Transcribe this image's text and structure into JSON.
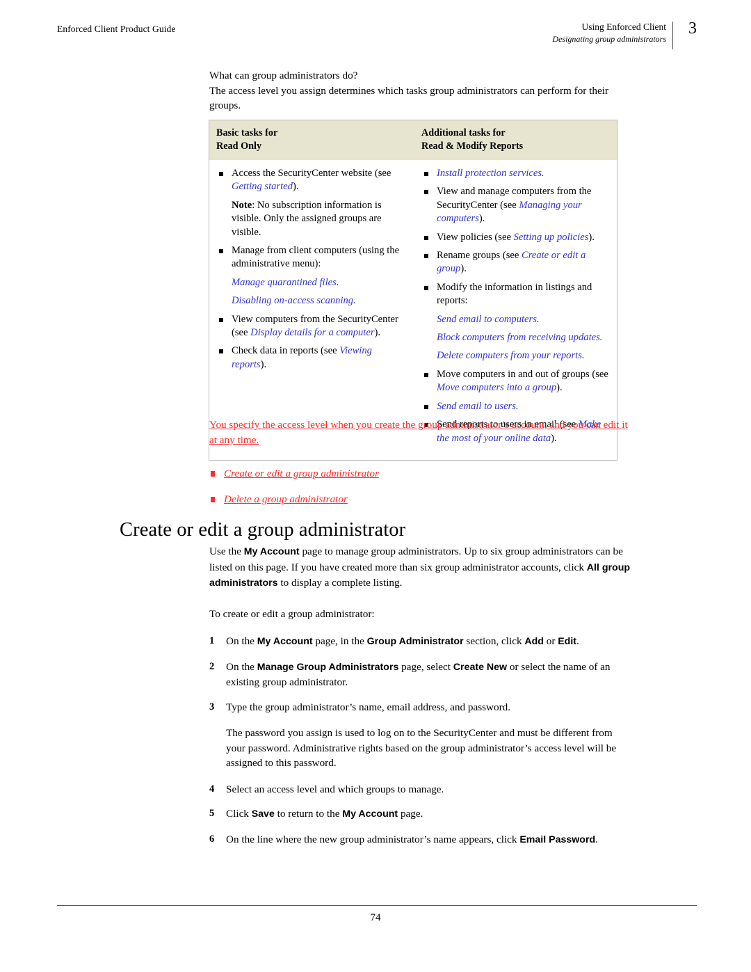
{
  "header": {
    "left": "Enforced Client Product Guide",
    "right_line1": "Using Enforced Client",
    "right_line2": "Designating group administrators",
    "chapter": "3"
  },
  "intro": {
    "line1": "What can group administrators do?",
    "line2": "The access level you assign determines which tasks group administrators can perform for their groups."
  },
  "table": {
    "headers": {
      "col1_line1": "Basic tasks for",
      "col1_line2": "Read Only",
      "col2_line1": "Additional tasks for",
      "col2_line2": "Read & Modify Reports"
    },
    "col1": {
      "item1_pre": "Access the SecurityCenter website (see ",
      "item1_link": "Getting started",
      "item1_post": ").",
      "note_label": "Note",
      "note_text": ": No subscription information is visible. Only the assigned groups are visible.",
      "item2": "Manage from client computers (using the administrative menu):",
      "sub1": "Manage quarantined files.",
      "sub2": "Disabling on-access scanning.",
      "item3_pre": "View computers from the SecurityCenter (see ",
      "item3_link": "Display details for a computer",
      "item3_post": ").",
      "item4_pre": "Check data in reports (see ",
      "item4_link": "Viewing reports",
      "item4_post": ")."
    },
    "col2": {
      "item1_link": "Install protection services.",
      "item2_pre": "View and manage computers from the SecurityCenter (see ",
      "item2_link": "Managing your computers",
      "item2_post": ").",
      "item3_pre": "View policies (see ",
      "item3_link": "Setting up policies",
      "item3_post": ").",
      "item4_pre": "Rename groups (see ",
      "item4_link": "Create or edit a group",
      "item4_post": ").",
      "item5": "Modify the information in listings and reports:",
      "sub1": "Send email to computers.",
      "sub2": "Block computers from receiving updates.",
      "sub3": "Delete computers from your reports.",
      "item6_pre": "Move computers in and out of groups (see ",
      "item6_link": "Move computers into a group",
      "item6_post": ").",
      "item7_link": "Send email to users.",
      "item8_pre": "Send reports to users in email (see ",
      "item8_link": "Make the most of your online data",
      "item8_post": ")."
    }
  },
  "red": {
    "paragraph": "You specify the access level when you create the group administrator’s account, and you can edit it at any time.",
    "links": [
      "Create or edit a group administrator",
      "Delete a group administrator"
    ]
  },
  "section": {
    "heading": "Create or edit a group administrator",
    "para1_a": "Use the ",
    "para1_b1": "My Account",
    "para1_c": " page to manage group administrators. Up to six group administrators can be listed on this page. If you have created more than six group administrator accounts, click ",
    "para1_b2": "All group administrators",
    "para1_d": " to display a complete listing.",
    "lead_in": "To create or edit a group administrator:"
  },
  "steps": [
    {
      "num": "1",
      "parts": [
        "On the ",
        "My Account",
        " page, in the ",
        "Group Administrator",
        " section, click ",
        "Add",
        " or ",
        "Edit",
        "."
      ]
    },
    {
      "num": "2",
      "parts": [
        "On the ",
        "Manage Group Administrators",
        " page, select ",
        "Create New",
        " or select the name of an existing group administrator."
      ]
    },
    {
      "num": "3",
      "parts": [
        "Type the group administrator’s name, email address, and password."
      ]
    },
    {
      "num": "4",
      "parts": [
        "Select an access level and which groups to manage."
      ]
    },
    {
      "num": "5",
      "parts": [
        "Click ",
        "Save",
        " to return to the ",
        "My Account",
        " page."
      ]
    },
    {
      "num": "6",
      "parts": [
        "On the line where the new group administrator’s name appears, click ",
        "Email Password",
        "."
      ]
    }
  ],
  "step3_note": "The password you assign is used to log on to the SecurityCenter and must be different from your password. Administrative rights based on the group administrator’s access level will be assigned to this password.",
  "footer": {
    "page_number": "74"
  },
  "colors": {
    "link_blue": "#3333cc",
    "highlight_red": "#ff2a2a",
    "table_header_bg": "#e7e5cf",
    "table_border": "#b9b9b9",
    "rule": "#555555"
  }
}
